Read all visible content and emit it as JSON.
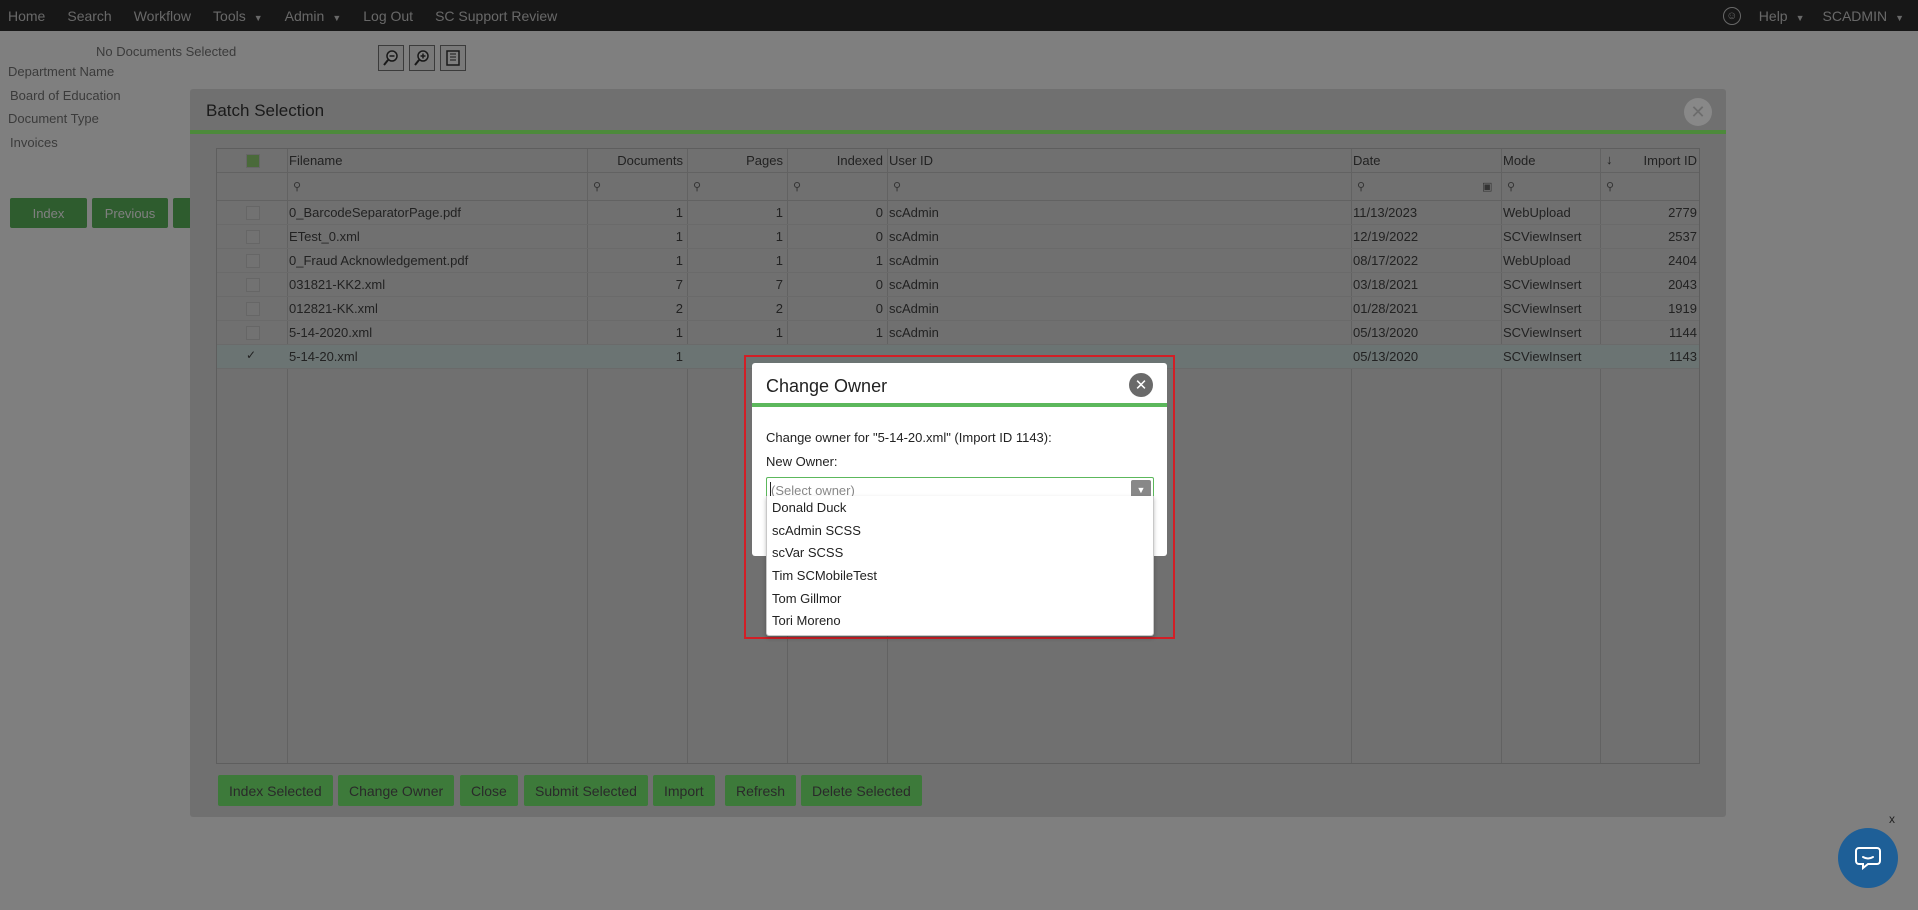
{
  "nav": {
    "left": [
      "Home",
      "Search",
      "Workflow",
      "Tools",
      "Admin",
      "Log Out",
      "SC Support Review"
    ],
    "help": "Help",
    "user": "SCADMIN"
  },
  "background": {
    "no_docs": "No Documents Selected",
    "department_name_label": "Department Name",
    "department_name_value": "Board of Education",
    "document_type_label": "Document Type",
    "document_type_value": "Invoices",
    "buttons": [
      "Index",
      "Previous",
      ""
    ]
  },
  "batch": {
    "title": "Batch Selection",
    "columns": {
      "filename": "Filename",
      "documents": "Documents",
      "pages": "Pages",
      "indexed": "Indexed",
      "user_id": "User ID",
      "date": "Date",
      "mode": "Mode",
      "import_id": "Import ID"
    },
    "rows": [
      {
        "filename": "0_BarcodeSeparatorPage.pdf",
        "documents": "1",
        "pages": "1",
        "indexed": "0",
        "user_id": "scAdmin",
        "date": "11/13/2023",
        "mode": "WebUpload",
        "import_id": "2779"
      },
      {
        "filename": "ETest_0.xml",
        "documents": "1",
        "pages": "1",
        "indexed": "0",
        "user_id": "scAdmin",
        "date": "12/19/2022",
        "mode": "SCViewInsert",
        "import_id": "2537"
      },
      {
        "filename": "0_Fraud Acknowledgement.pdf",
        "documents": "1",
        "pages": "1",
        "indexed": "1",
        "user_id": "scAdmin",
        "date": "08/17/2022",
        "mode": "WebUpload",
        "import_id": "2404"
      },
      {
        "filename": "031821-KK2.xml",
        "documents": "7",
        "pages": "7",
        "indexed": "0",
        "user_id": "scAdmin",
        "date": "03/18/2021",
        "mode": "SCViewInsert",
        "import_id": "2043"
      },
      {
        "filename": "012821-KK.xml",
        "documents": "2",
        "pages": "2",
        "indexed": "0",
        "user_id": "scAdmin",
        "date": "01/28/2021",
        "mode": "SCViewInsert",
        "import_id": "1919"
      },
      {
        "filename": "5-14-2020.xml",
        "documents": "1",
        "pages": "1",
        "indexed": "1",
        "user_id": "scAdmin",
        "date": "05/13/2020",
        "mode": "SCViewInsert",
        "import_id": "1144"
      },
      {
        "filename": "5-14-20.xml",
        "documents": "1",
        "pages": "",
        "indexed": "",
        "user_id": "",
        "date": "05/13/2020",
        "mode": "SCViewInsert",
        "import_id": "1143"
      }
    ],
    "buttons": [
      "Index Selected",
      "Change Owner",
      "Close",
      "Submit Selected",
      "Import",
      "Refresh",
      "Delete Selected"
    ]
  },
  "change_owner": {
    "title": "Change Owner",
    "prompt": "Change owner for \"5-14-20.xml\" (Import ID 1143):",
    "new_owner_label": "New Owner:",
    "placeholder": "(Select owner)",
    "options": [
      "Donald Duck",
      "scAdmin SCSS",
      "scVar SCSS",
      "Tim SCMobileTest",
      "Tom Gillmor",
      "Tori Moreno"
    ]
  },
  "chat": {
    "close": "x"
  },
  "colors": {
    "accent_green": "#5cb85c",
    "highlight_red": "#d21f26",
    "chat_blue": "#1e5f97"
  }
}
